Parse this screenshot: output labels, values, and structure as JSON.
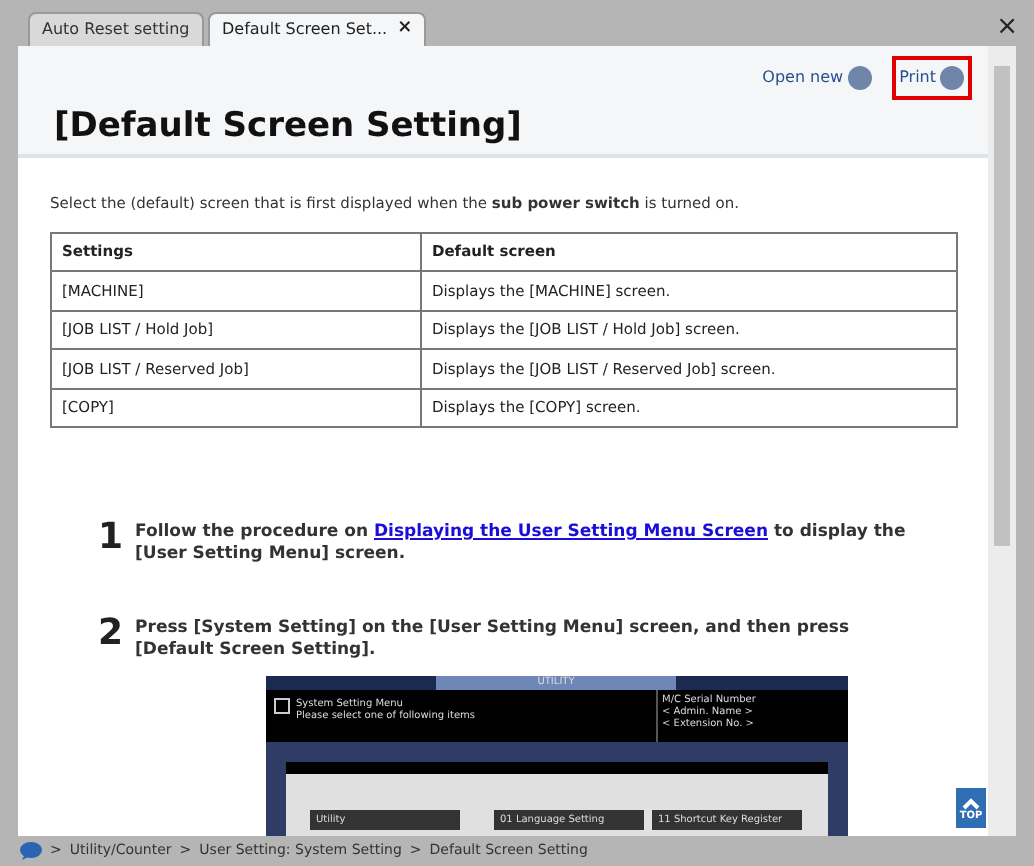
{
  "tabs": [
    {
      "label": "Auto Reset setting",
      "selected": false
    },
    {
      "label": "Default Screen Set...",
      "selected": true,
      "close": "×"
    }
  ],
  "window_close": "×",
  "header": {
    "open_new": "Open new",
    "print": "Print",
    "title": "[Default Screen Setting]"
  },
  "intro": "Select the (default) screen that is first displayed when the **sub power switch** is turned on.",
  "table": {
    "columns": [
      "Settings",
      "Default screen"
    ],
    "rows": [
      [
        "[MACHINE]",
        "Displays the [MACHINE] screen."
      ],
      [
        "[JOB LIST / Hold Job]",
        "Displays the [JOB LIST / Hold Job] screen."
      ],
      [
        "[JOB LIST / Reserved Job]",
        "Displays the [JOB LIST / Reserved Job] screen."
      ],
      [
        "[COPY]",
        "Displays the [COPY] screen."
      ]
    ]
  },
  "steps": [
    {
      "number": "1",
      "before": "Follow the procedure on ",
      "link": "Displaying the User Setting Menu Screen",
      "after": " to display the [User Setting Menu] screen."
    },
    {
      "number": "2",
      "before": "Press [System Setting] on the [User Setting Menu] screen, and then press [Default Screen Setting]."
    }
  ],
  "device_screen": {
    "tab": "UTILITY",
    "menu_title": "System Setting Menu",
    "menu_hint": "Please select one of following items",
    "serial": "M/C Serial Number",
    "admin": "< Admin. Name >",
    "extension": "< Extension No. >",
    "left_button": "Utility",
    "buttons": [
      "01 Language Setting",
      "11 Shortcut Key Register"
    ]
  },
  "top_button": "TOP",
  "breadcrumb": [
    "Utility/Counter",
    "User Setting: System Setting",
    "Default Screen Setting"
  ],
  "breadcrumb_separator": ">"
}
